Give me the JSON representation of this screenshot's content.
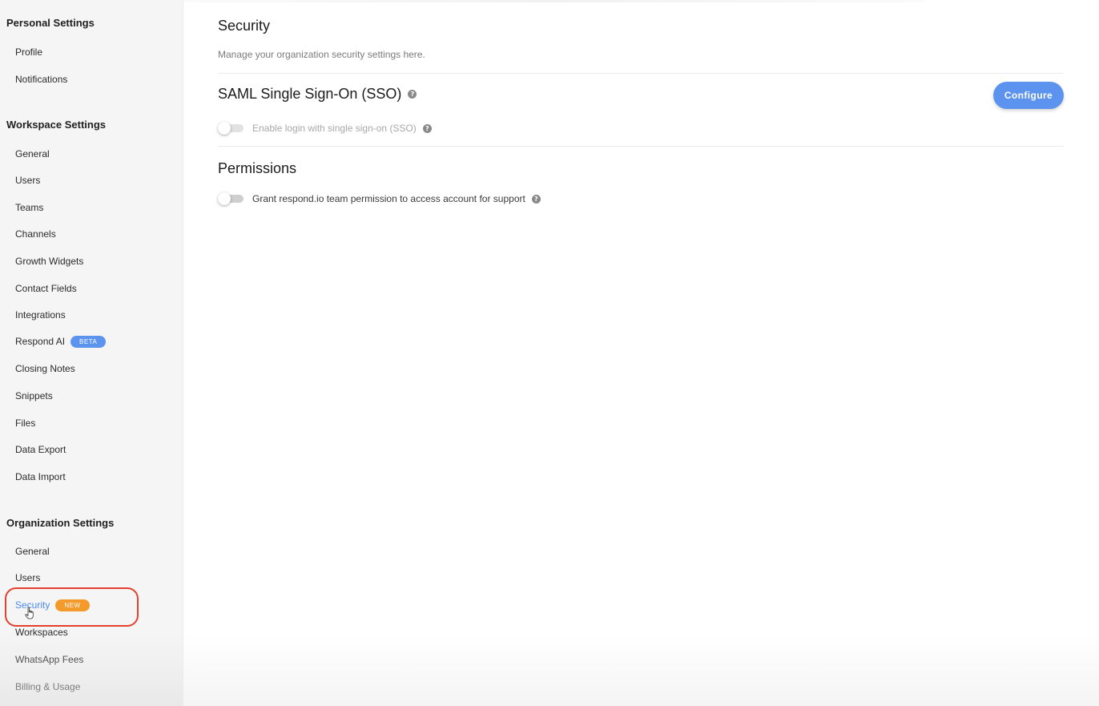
{
  "sidebar": {
    "personal": {
      "title": "Personal Settings",
      "items": [
        {
          "label": "Profile"
        },
        {
          "label": "Notifications"
        }
      ]
    },
    "workspace": {
      "title": "Workspace Settings",
      "items": [
        {
          "label": "General"
        },
        {
          "label": "Users"
        },
        {
          "label": "Teams"
        },
        {
          "label": "Channels"
        },
        {
          "label": "Growth Widgets"
        },
        {
          "label": "Contact Fields"
        },
        {
          "label": "Integrations"
        },
        {
          "label": "Respond AI",
          "badge": "BETA"
        },
        {
          "label": "Closing Notes"
        },
        {
          "label": "Snippets"
        },
        {
          "label": "Files"
        },
        {
          "label": "Data Export"
        },
        {
          "label": "Data Import"
        }
      ]
    },
    "organization": {
      "title": "Organization Settings",
      "items": [
        {
          "label": "General"
        },
        {
          "label": "Users"
        },
        {
          "label": "Security",
          "badge": "NEW",
          "active": true
        },
        {
          "label": "Workspaces"
        },
        {
          "label": "WhatsApp Fees"
        },
        {
          "label": "Billing & Usage"
        }
      ]
    }
  },
  "main": {
    "title": "Security",
    "subtitle": "Manage your organization security settings here.",
    "sso": {
      "heading": "SAML Single Sign-On (SSO)",
      "help_icon": "?",
      "configure_label": "Configure",
      "toggle_label": "Enable login with single sign-on (SSO)",
      "toggle_on": false,
      "toggle_disabled": true
    },
    "permissions": {
      "heading": "Permissions",
      "toggle_label": "Grant respond.io team permission to access account for support",
      "toggle_on": false
    }
  },
  "colors": {
    "accent": "#5b93ef",
    "active_link": "#4a8bf0",
    "new_badge": "#f39a2b",
    "highlight_ring": "#e3412f"
  },
  "icons": {
    "help": "question-circle-icon",
    "cursor": "hand-pointer-icon"
  }
}
